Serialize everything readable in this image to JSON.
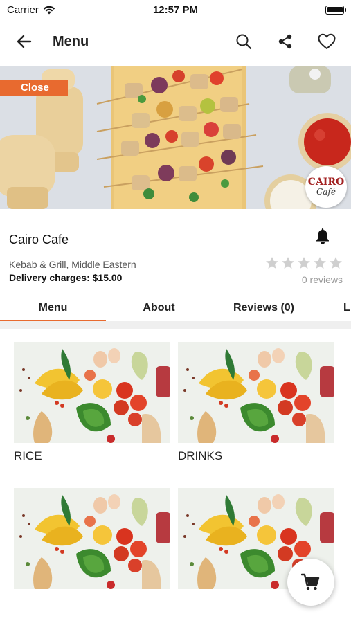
{
  "status_bar": {
    "carrier": "Carrier",
    "time": "12:57 PM"
  },
  "nav": {
    "title": "Menu",
    "icons": [
      "back-arrow-icon",
      "search-icon",
      "share-icon",
      "heart-icon"
    ]
  },
  "hero": {
    "status_tag": "Close",
    "logo_text_top": "CAIRO",
    "logo_text_bottom": "Café"
  },
  "restaurant": {
    "name": "Cairo Cafe",
    "cuisine": "Kebab & Grill, Middle Eastern",
    "delivery_charges": "Delivery charges: $15.00",
    "rating": 0,
    "reviews_label": "0 reviews"
  },
  "tabs": [
    {
      "label": "Menu",
      "active": true
    },
    {
      "label": "About",
      "active": false
    },
    {
      "label": "Reviews (0)",
      "active": false
    },
    {
      "label": "L",
      "active": false
    }
  ],
  "categories": [
    {
      "label": "RICE"
    },
    {
      "label": "DRINKS"
    },
    {
      "label": ""
    },
    {
      "label": ""
    }
  ],
  "colors": {
    "accent": "#e86a2f",
    "star_empty": "#cfcfcf",
    "muted_text": "#9a9a9a"
  }
}
